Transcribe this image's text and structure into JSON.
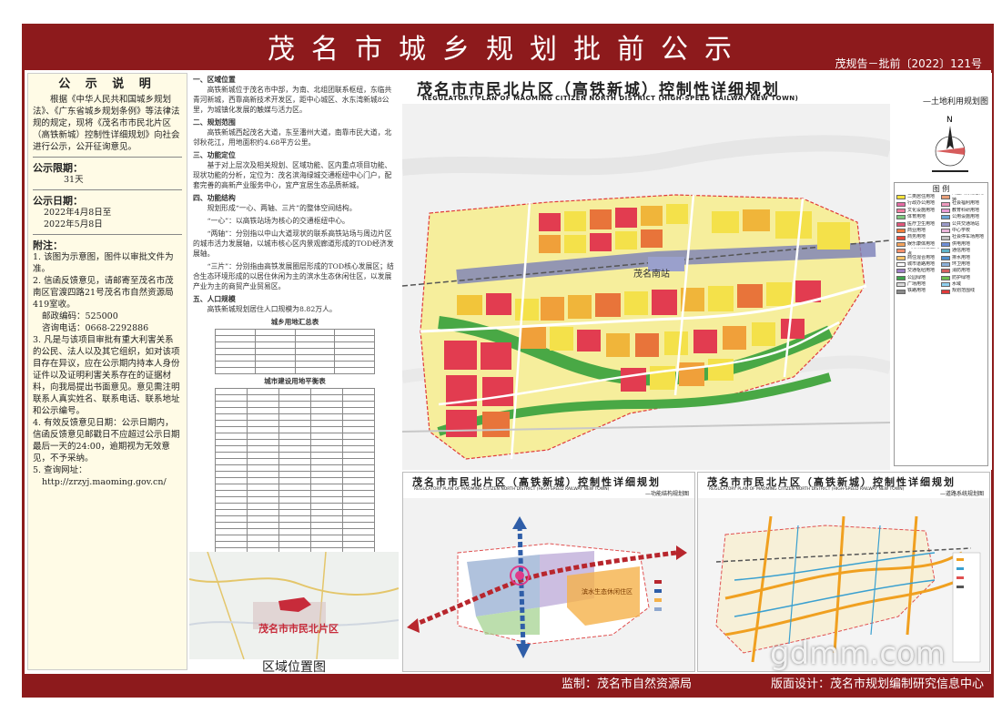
{
  "banner": {
    "title": "茂名市城乡规划批前公示",
    "doc_no": "茂规告－批前〔2022〕121号"
  },
  "notice": {
    "heading": "公 示 说 明",
    "intro": "根据《中华人民共和国城乡规划法》、《广东省城乡规划条例》等法律法规的规定，现将《茂名市市民北片区（高铁新城）控制性详细规划》向社会进行公示，公开征询意见。",
    "period_label": "公示限期：",
    "period_value": "31天",
    "date_label": "公示日期：",
    "date_start": "2022年4月8日至",
    "date_end": "2022年5月8日",
    "notes_label": "附注：",
    "notes": [
      "1. 该图为示意图，图件以审批文件为准。",
      "2. 信函反馈意见，请邮寄至茂名市茂南区官渡四路21号茂名市自然资源局419室收。",
      "邮政编码：525000",
      "咨询电话：0668-2292886",
      "3. 凡是与该项目审批有重大利害关系的公民、法人以及其它组织，如对该项目存在异议，应在公示期内持本人身份证件以及证明利害关系存在的证据材料，向我局提出书面意见。意见需注明联系人真实姓名、联系电话、联系地址和公示编号。",
      "4. 有效反馈意见日期：公示日期内，信函反馈意见邮戳日不应超过公示日期最后一天的24:00，逾期视为无效意见，不予采纳。",
      "5. 查询网址：",
      "http://zrzyj.maoming.gov.cn/"
    ]
  },
  "middle": {
    "sections": [
      {
        "head": "一、区域位置",
        "text": "高铁新城位于茂名市中部，为南、北组团联系枢纽，东临共青河新城，西靠高新技术开发区，距中心城区、水东湾新城8公里，为城镇化发展的触媒与活力区。"
      },
      {
        "head": "二、规划范围",
        "text": "高铁新城西起茂名大道，东至潘州大道，南靠市民大道，北邻秋花江，用地面积约4.68平方公里。"
      },
      {
        "head": "三、功能定位",
        "text": "基于对上层次及相关规划、区域功能、区内重点项目功能、现状功能的分析，定位为：茂名滨海绿城交通枢纽中心门户，配套完善的高新产业服务中心，宜产宜居生态品质新城。"
      },
      {
        "head": "四、功能结构",
        "text": "规划形成“一心、两轴、三片”的整体空间结构。"
      },
      {
        "head": "",
        "text": "“一心”：以高铁站场为核心的交通枢纽中心。"
      },
      {
        "head": "",
        "text": "“两轴”：分别指以中山大道现状的联系高铁站场与周边片区的城市活力发展轴，以城市核心区内景观廊道形成的TOD经济发展轴。"
      },
      {
        "head": "",
        "text": "“三片”：分别指由高铁发展圈层形成的TOD核心发展区；结合生态环境形成的以居住休闲为主的滨水生态休闲住区，以发展产业为主的商贸产业贸易区。"
      },
      {
        "head": "五、人口规模",
        "text": "高铁新城规划居住人口规模为8.82万人。"
      }
    ],
    "table1_title": "城乡用地汇总表",
    "table2_title": "城市建设用地平衡表",
    "location_caption": "区域位置图",
    "location_label": "茂名市市民北片区"
  },
  "main_map": {
    "title": "茂名市市民北片区（高铁新城）控制性详细规划",
    "title_en": "REGULATORY PLAN OF MAOMING CITIZEN NORTH DISTRICT (HIGH-SPEED RAILWAY NEW TOWN)",
    "subtitle": "—土地利用规划图",
    "legend_title": "图  例",
    "station_label": "茂名南站",
    "north_label": "N",
    "legend_items": [
      {
        "label": "二类居住用地",
        "color": "#f5e23a"
      },
      {
        "label": "商业商务混合用地",
        "color": "#e8a07a"
      },
      {
        "label": "行政办公用地",
        "color": "#e56ba3"
      },
      {
        "label": "社会福利用地",
        "color": "#ee9abe"
      },
      {
        "label": "文化设施用地",
        "color": "#f07a9f"
      },
      {
        "label": "教育科研用地",
        "color": "#e89bd3"
      },
      {
        "label": "体育用地",
        "color": "#7dc87f"
      },
      {
        "label": "公用设施用地",
        "color": "#6aa4d6"
      },
      {
        "label": "医疗卫生用地",
        "color": "#e0567a"
      },
      {
        "label": "公共交通场站",
        "color": "#9a9ac8"
      },
      {
        "label": "商业用地",
        "color": "#f27d3b"
      },
      {
        "label": "中心学校",
        "color": "#e8b4d8"
      },
      {
        "label": "商务用地",
        "color": "#e94a3a"
      },
      {
        "label": "社会停车场用地",
        "color": "#c0c0c0"
      },
      {
        "label": "娱乐康体用地",
        "color": "#f3a25b"
      },
      {
        "label": "供电用地",
        "color": "#6f8fd6"
      },
      {
        "label": "公用设施营业网点",
        "color": "#f58f6a"
      },
      {
        "label": "通信用地",
        "color": "#5fb3c8"
      },
      {
        "label": "商住混合用地",
        "color": "#f7c46a"
      },
      {
        "label": "排水用地",
        "color": "#4f8fcf"
      },
      {
        "label": "城市道路用地",
        "color": "#ffffff"
      },
      {
        "label": "环卫用地",
        "color": "#8bb0d8"
      },
      {
        "label": "交通枢纽用地",
        "color": "#9e7fc8"
      },
      {
        "label": "消防用地",
        "color": "#d46060"
      },
      {
        "label": "公园绿地",
        "color": "#3fa34d"
      },
      {
        "label": "防护绿地",
        "color": "#6fbf4f"
      },
      {
        "label": "广场用地",
        "color": "#d8d8d8"
      },
      {
        "label": "水域",
        "color": "#8fd0ef"
      },
      {
        "label": "铁路用地",
        "color": "#8a8a8a"
      },
      {
        "label": "规划范围线",
        "color": "#e03a3a"
      }
    ]
  },
  "sub_map_left": {
    "title": "茂名市市民北片区（高铁新城）控制性详细规划",
    "title_en": "REGULATORY PLAN OF MAOMING CITIZEN NORTH DISTRICT (HIGH-SPEED RAILWAY NEW TOWN)",
    "subtitle": "—功能结构规划图",
    "label_a": "滨水生态休闲住区"
  },
  "sub_map_right": {
    "title": "茂名市市民北片区（高铁新城）控制性详细规划",
    "title_en": "REGULATORY PLAN OF MAOMING CITIZEN NORTH DISTRICT (HIGH-SPEED RAILWAY NEW TOWN)",
    "subtitle": "—道路系统规划图"
  },
  "footer": {
    "supervisor": "监制：茂名市自然资源局",
    "designer": "版面设计：茂名市规划编制研究信息中心"
  },
  "watermark": "gdmm.com"
}
